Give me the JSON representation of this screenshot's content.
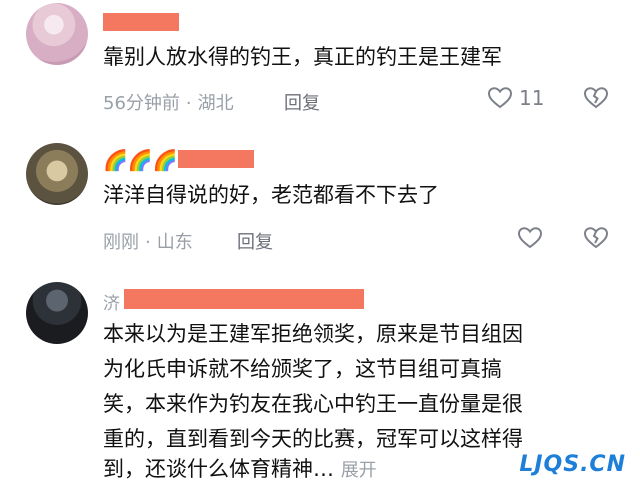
{
  "comments": [
    {
      "username_prefix": "",
      "text_lines": [
        "靠别人放水得的钓王，真正的钓王是王建军"
      ],
      "time": "56分钟前",
      "location": "湖北",
      "reply_label": "回复",
      "like_count": "11"
    },
    {
      "username_prefix": "🌈🌈🌈",
      "text_lines": [
        "洋洋自得说的好，老范都看不下去了"
      ],
      "time": "刚刚",
      "location": "山东",
      "reply_label": "回复",
      "like_count": ""
    },
    {
      "username_prefix": "济",
      "text_lines": [
        "本来以为是王建军拒绝领奖，原来是节目组因",
        "为化氏申诉就不给颁奖了，这节目组可真搞",
        "笑，本来作为钓友在我心中钓王一直份量是很",
        "重的，直到看到今天的比赛，冠军可以这样得",
        "到，还谈什么体育精神…"
      ],
      "expand_label": "展开"
    }
  ],
  "watermark": "LJQS.CN",
  "icons": {
    "like": "heart-outline-icon",
    "dislike": "broken-heart-icon"
  },
  "colors": {
    "redaction": "#f4785f",
    "watermark": "#1d7fd8"
  }
}
